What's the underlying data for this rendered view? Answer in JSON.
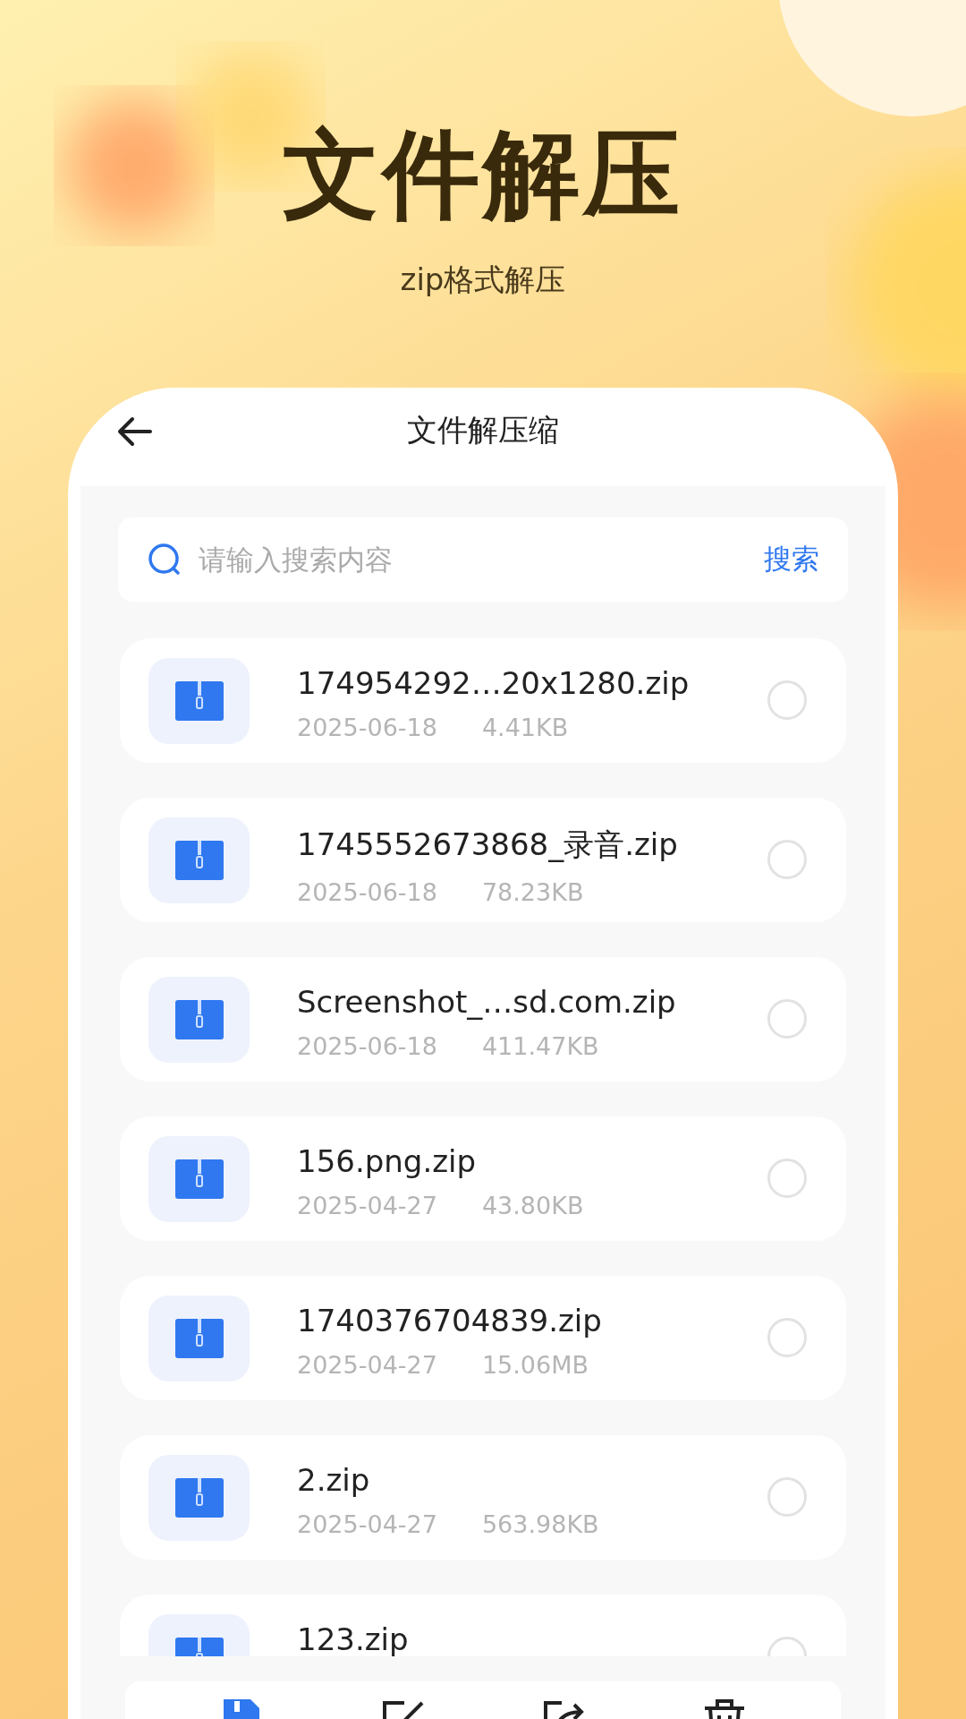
{
  "hero": {
    "title": "文件解压",
    "subtitle": "zip格式解压"
  },
  "header": {
    "title": "文件解压缩"
  },
  "search": {
    "placeholder": "请输入搜索内容",
    "button": "搜索"
  },
  "files": [
    {
      "name": "174954292…20x1280.zip",
      "date": "2025-06-18",
      "size": "4.41KB",
      "selected": false
    },
    {
      "name": "1745552673868_录音.zip",
      "date": "2025-06-18",
      "size": "78.23KB",
      "selected": false
    },
    {
      "name": "Screenshot_…sd.com.zip",
      "date": "2025-06-18",
      "size": "411.47KB",
      "selected": false
    },
    {
      "name": "156.png.zip",
      "date": "2025-04-27",
      "size": "43.80KB",
      "selected": false
    },
    {
      "name": "1740376704839.zip",
      "date": "2025-04-27",
      "size": "15.06MB",
      "selected": false
    },
    {
      "name": "2.zip",
      "date": "2025-04-27",
      "size": "563.98KB",
      "selected": false
    },
    {
      "name": "123.zip",
      "selected": false
    }
  ],
  "bottom_tabs": [
    {
      "selected": true
    },
    {
      "selected": false
    },
    {
      "selected": false
    },
    {
      "selected": false
    }
  ]
}
